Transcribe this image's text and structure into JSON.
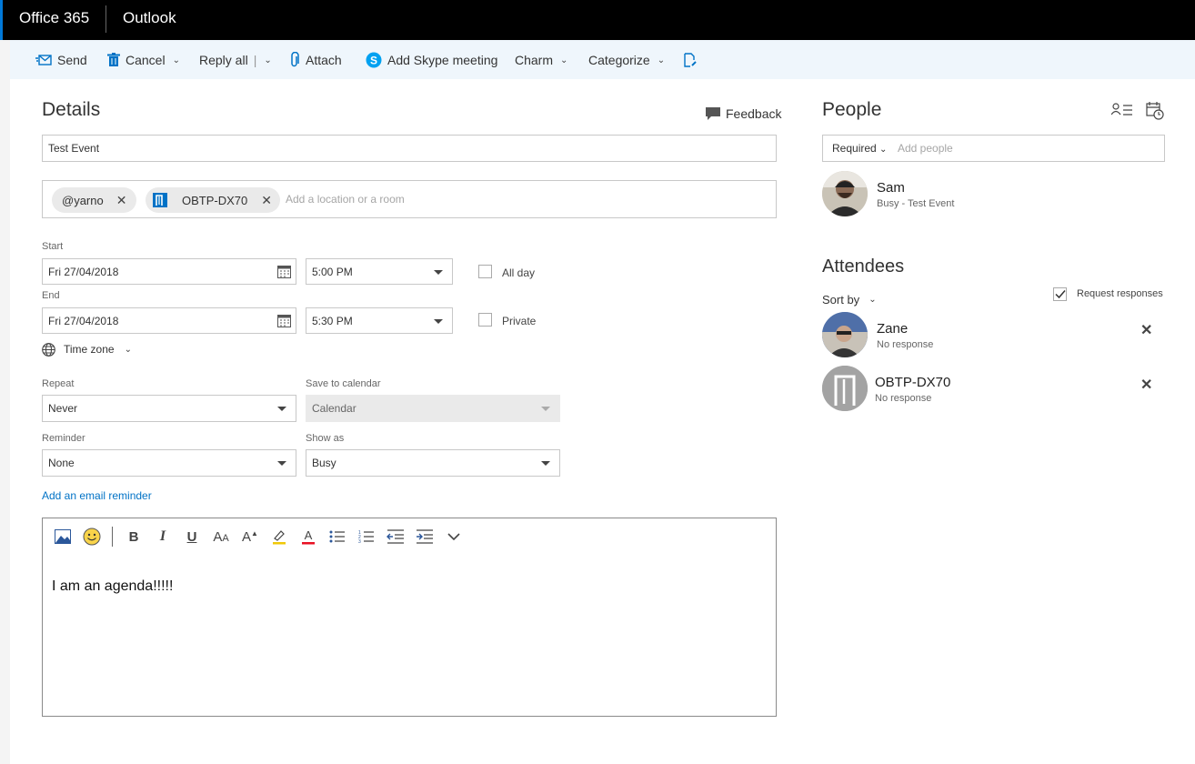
{
  "topbar": {
    "brand": "Office 365",
    "app": "Outlook"
  },
  "toolbar": {
    "send": "Send",
    "cancel": "Cancel",
    "reply_all": "Reply all",
    "attach": "Attach",
    "skype": "Add Skype meeting",
    "charm": "Charm",
    "categorize": "Categorize"
  },
  "details": {
    "heading": "Details",
    "feedback": "Feedback",
    "title_value": "Test Event",
    "location_chips": [
      "@yarno",
      "OBTP-DX70"
    ],
    "location_placeholder": "Add a location or a room",
    "start_label": "Start",
    "start_date": "Fri 27/04/2018",
    "start_time": "5:00 PM",
    "all_day": "All day",
    "end_label": "End",
    "end_date": "Fri 27/04/2018",
    "end_time": "5:30 PM",
    "private": "Private",
    "time_zone": "Time zone",
    "repeat_label": "Repeat",
    "repeat_value": "Never",
    "save_to_label": "Save to calendar",
    "save_to_value": "Calendar",
    "reminder_label": "Reminder",
    "reminder_value": "None",
    "show_as_label": "Show as",
    "show_as_value": "Busy",
    "email_reminder": "Add an email reminder",
    "body_text": "I am an agenda!!!!!"
  },
  "people": {
    "heading": "People",
    "required_label": "Required",
    "add_people_placeholder": "Add people",
    "organizer": {
      "name": "Sam",
      "status": "Busy - Test Event"
    },
    "attendees_heading": "Attendees",
    "sort_by": "Sort by",
    "request_responses": "Request responses",
    "attendees": [
      {
        "name": "Zane",
        "status": "No response"
      },
      {
        "name": "OBTP-DX70",
        "status": "No response"
      }
    ]
  },
  "colors": {
    "accent": "#0078d7",
    "link": "#0072c6",
    "toolbar_bg": "#eff6fc",
    "topbar_bg": "#000000"
  }
}
